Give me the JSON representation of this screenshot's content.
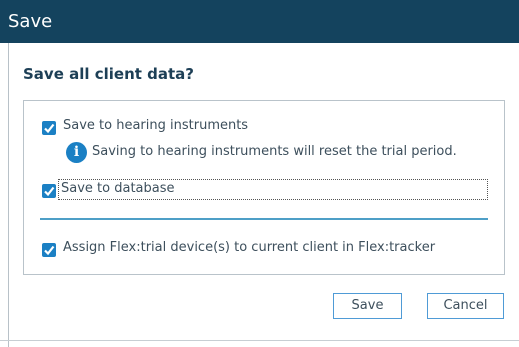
{
  "window": {
    "title": "Save"
  },
  "dialog": {
    "heading": "Save all client data?",
    "options": [
      {
        "label": "Save to hearing instruments",
        "checked": true
      },
      {
        "label": "Save to database",
        "checked": true
      },
      {
        "label": "Assign Flex:trial device(s) to current client in Flex:tracker",
        "checked": true
      }
    ],
    "info_text": "Saving to hearing instruments will reset the trial period.",
    "info_icon": "info-icon"
  },
  "buttons": {
    "save_label": "Save",
    "cancel_label": "Cancel"
  },
  "colors": {
    "titlebar": "#14435e",
    "accent": "#1b80c4",
    "divider": "#4e9fc7",
    "button_border": "#4f9bd6"
  }
}
